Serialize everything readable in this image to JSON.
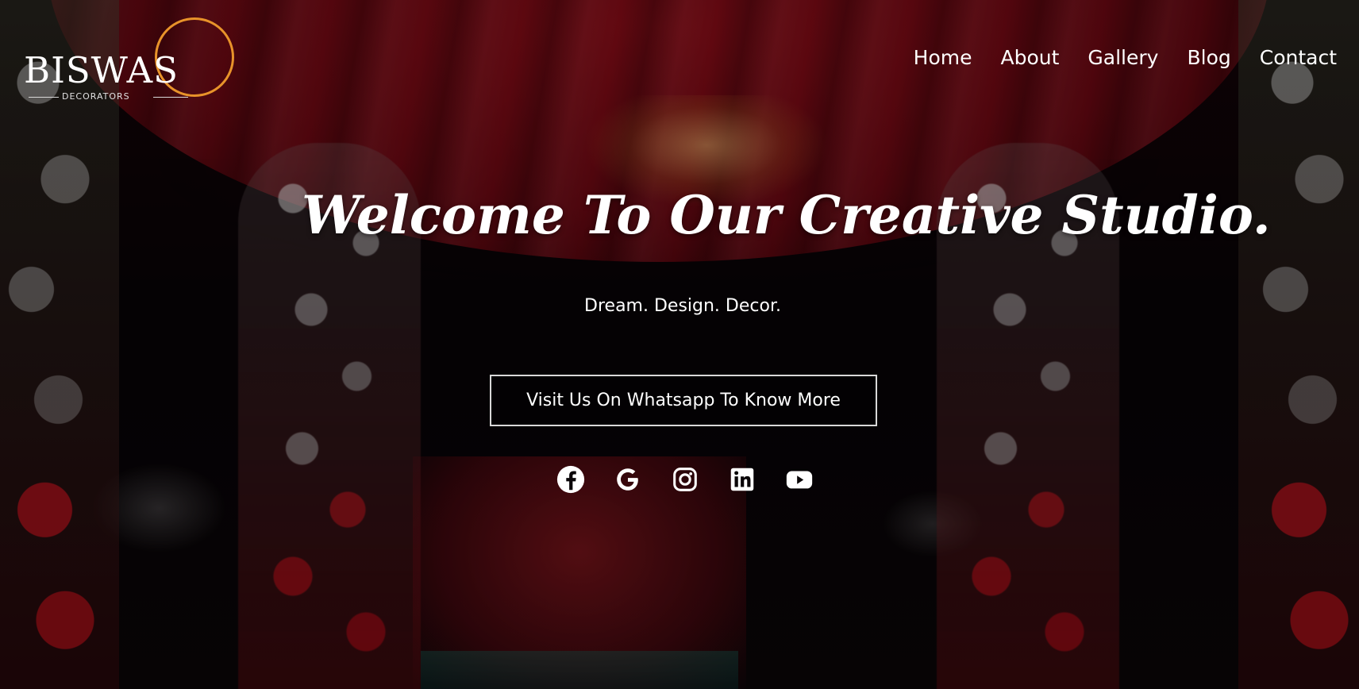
{
  "logo": {
    "name": "BISWAS",
    "subtitle": "DECORATORS",
    "ring_color": "#e8932a"
  },
  "nav": {
    "items": [
      "Home",
      "About",
      "Gallery",
      "Blog",
      "Contact"
    ]
  },
  "hero": {
    "headline": "Welcome To Our Creative Studio.",
    "tagline": "Dream. Design. Decor.",
    "cta_label": "Visit Us On Whatsapp To Know More"
  },
  "socials": [
    {
      "icon": "facebook-icon"
    },
    {
      "icon": "google-icon"
    },
    {
      "icon": "instagram-icon"
    },
    {
      "icon": "linkedin-icon"
    },
    {
      "icon": "youtube-icon"
    }
  ],
  "colors": {
    "drape_red": "#6a0812",
    "text": "#ffffff",
    "accent": "#e8932a"
  }
}
